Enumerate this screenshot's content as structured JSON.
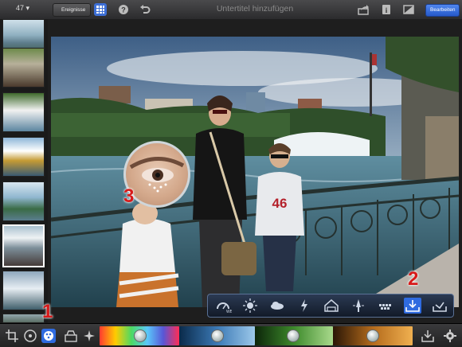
{
  "toolbar": {
    "photo_count": "47 ▾",
    "back_label": "Ereignisse",
    "title_placeholder": "Untertitel hinzufügen",
    "edit_label": "Bearbeiten",
    "icons": [
      "grid-icon",
      "help-icon",
      "undo-icon",
      "share-icon",
      "info-icon",
      "compare-icon"
    ]
  },
  "callouts": {
    "one": "1",
    "two": "2",
    "three": "3"
  },
  "photo": {
    "jersey_number": "46"
  },
  "brushes": [
    "white-balance-brush-icon",
    "lighten-brush-icon",
    "darken-brush-icon",
    "saturate-brush-icon",
    "desaturate-brush-icon",
    "sharpen-brush-icon",
    "soften-brush-icon",
    "repair-brush-icon",
    "red-eye-brush-icon",
    "tool-tray-icon"
  ],
  "bottom_tools": [
    "crop-icon",
    "straighten-icon",
    "exposure-icon",
    "color-icon",
    "brushes-icon",
    "effects-icon",
    "share-tool-icon",
    "settings-icon"
  ],
  "colors": {
    "accent": "#2f6be0",
    "callout": "#d71a1a"
  }
}
